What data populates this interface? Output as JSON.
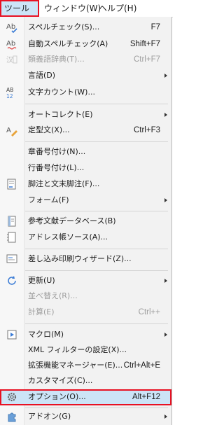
{
  "menubar": {
    "items": [
      {
        "label": "ツール(T)",
        "active": true
      },
      {
        "label": "ウィンドウ(W)",
        "active": false
      },
      {
        "label": "ヘルプ(H)",
        "active": false
      }
    ]
  },
  "menu": {
    "items": [
      {
        "label": "スペルチェック(S)...",
        "shortcut": "F7",
        "icon": "spellcheck-icon"
      },
      {
        "label": "自動スペルチェック(A)",
        "shortcut": "Shift+F7",
        "icon": "auto-spellcheck-icon"
      },
      {
        "label": "類義語辞典(T)...",
        "shortcut": "Ctrl+F7",
        "icon": "thesaurus-icon",
        "disabled": true
      },
      {
        "label": "言語(D)",
        "icon": "language-icon",
        "submenu": true
      },
      {
        "label": "文字カウント(W)...",
        "icon": "word-count-icon"
      },
      {
        "label": "オートコレクト(E)",
        "icon": "autocorrect-icon",
        "submenu": true
      },
      {
        "label": "定型文(X)...",
        "shortcut": "Ctrl+F3",
        "icon": "autotext-icon"
      },
      {
        "label": "章番号付け(N)...",
        "icon": "chapter-numbering-icon"
      },
      {
        "label": "行番号付け(L)...",
        "icon": "line-numbering-icon"
      },
      {
        "label": "脚注と文末脚注(F)...",
        "icon": "footnote-icon"
      },
      {
        "label": "フォーム(F)",
        "icon": "form-icon",
        "submenu": true
      },
      {
        "label": "参考文献データベース(B)",
        "icon": "bibliography-database-icon"
      },
      {
        "label": "アドレス帳ソース(A)...",
        "icon": "address-book-source-icon"
      },
      {
        "label": "差し込み印刷ウィザード(Z)...",
        "icon": "mail-merge-wizard-icon"
      },
      {
        "label": "更新(U)",
        "icon": "update-icon",
        "submenu": true
      },
      {
        "label": "並べ替え(R)...",
        "icon": "sort-icon",
        "disabled": true
      },
      {
        "label": "計算(E)",
        "shortcut": "Ctrl++",
        "icon": "calculate-icon",
        "disabled": true
      },
      {
        "label": "マクロ(M)",
        "icon": "macros-icon",
        "submenu": true
      },
      {
        "label": "XML フィルターの設定(X)...",
        "icon": "xml-filter-icon"
      },
      {
        "label": "拡張機能マネージャー(E)...",
        "shortcut": "Ctrl+Alt+E",
        "icon": "extension-manager-icon"
      },
      {
        "label": "カスタマイズ(C)...",
        "icon": "customize-icon"
      },
      {
        "label": "オプション(O)...",
        "shortcut": "Alt+F12",
        "icon": "options-gear-icon",
        "selected": true
      },
      {
        "label": "アドオン(G)",
        "icon": "addons-icon",
        "submenu": true
      }
    ]
  }
}
